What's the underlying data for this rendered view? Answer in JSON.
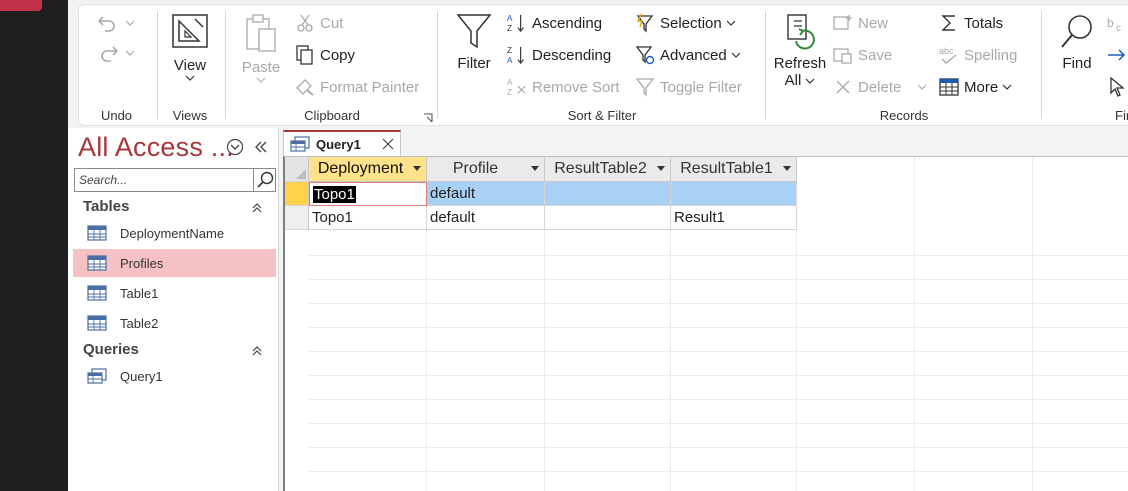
{
  "ribbon": {
    "groups": {
      "undo": "Undo",
      "views": "Views",
      "clipboard": "Clipboard",
      "sort_filter": "Sort & Filter",
      "records": "Records",
      "find": "Fin"
    },
    "view_label": "View",
    "paste_label": "Paste",
    "cut_label": "Cut",
    "copy_label": "Copy",
    "format_painter_label": "Format Painter",
    "filter_label": "Filter",
    "ascending_label": "Ascending",
    "descending_label": "Descending",
    "remove_sort_label": "Remove Sort",
    "selection_label": "Selection",
    "advanced_label": "Advanced",
    "toggle_filter_label": "Toggle Filter",
    "refresh_label": "Refresh",
    "refresh_all_label": "All",
    "new_label": "New",
    "save_label": "Save",
    "delete_label": "Delete",
    "totals_label": "Totals",
    "spelling_label": "Spelling",
    "more_label": "More",
    "find_label": "Find"
  },
  "nav": {
    "title": "All Access ...",
    "search_placeholder": "Search...",
    "tables_header": "Tables",
    "queries_header": "Queries",
    "tables": [
      "DeploymentName",
      "Profiles",
      "Table1",
      "Table2"
    ],
    "queries": [
      "Query1"
    ]
  },
  "doc": {
    "tab_label": "Query1",
    "columns": [
      "Deployment",
      "Profile",
      "ResultTable2",
      "ResultTable1"
    ],
    "rows": [
      [
        "Topo1",
        "default",
        "",
        ""
      ],
      [
        "Topo1",
        "default",
        "",
        "Result1"
      ]
    ]
  },
  "colors": {
    "accent": "#a4373a",
    "selected_nav": "#f5c1c4",
    "active_header": "#ffe28a",
    "selected_row": "#a9d0f5"
  }
}
